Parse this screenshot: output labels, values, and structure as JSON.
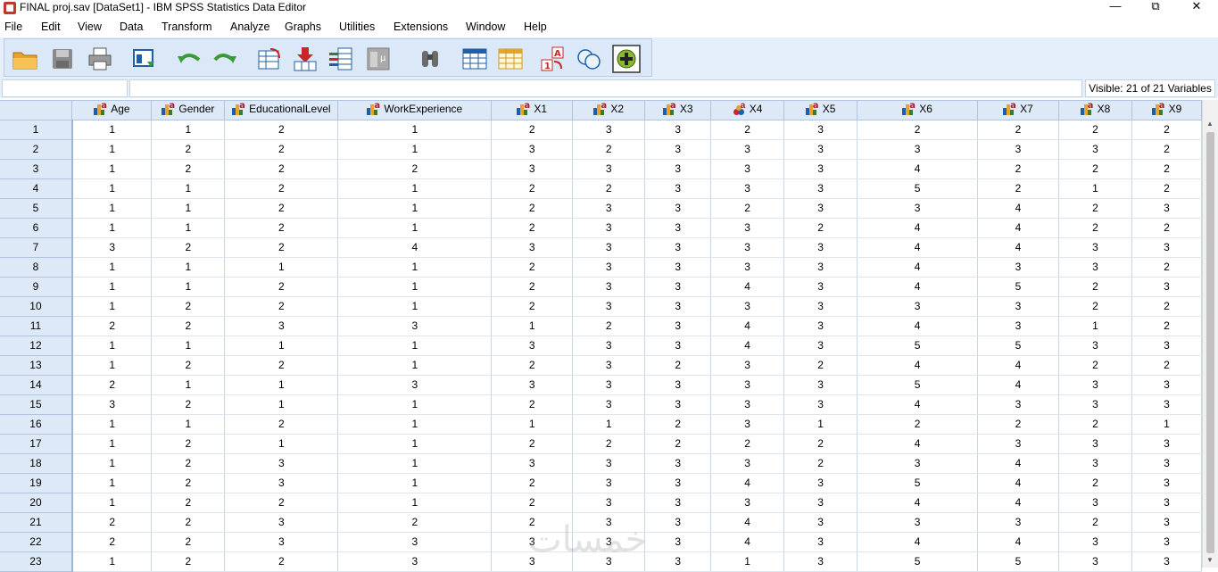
{
  "window": {
    "title": "FINAL proj.sav [DataSet1] - IBM SPSS Statistics Data Editor",
    "minimize": "—",
    "restore": "⧉",
    "close": "✕"
  },
  "menu": [
    "File",
    "Edit",
    "View",
    "Data",
    "Transform",
    "Analyze",
    "Graphs",
    "Utilities",
    "Extensions",
    "Window",
    "Help"
  ],
  "toolbar": {
    "icons": [
      "open-folder-icon",
      "save-icon",
      "print-icon",
      "recall-dialog-icon",
      "undo-icon",
      "redo-icon",
      "go-to-case-icon",
      "go-to-variable-icon",
      "variables-icon",
      "run-descriptives-icon",
      "find-icon",
      "insert-cases-icon",
      "insert-variable-icon",
      "value-labels-icon",
      "use-variable-sets-icon",
      "show-all-variables-icon"
    ]
  },
  "cellbar": {
    "cell_ref": "",
    "cell_value": "",
    "visible_label": "Visible: 21 of 21 Variables"
  },
  "grid": {
    "columns": [
      {
        "name": "Age",
        "icon": "scale"
      },
      {
        "name": "Gender",
        "icon": "scale"
      },
      {
        "name": "EducationalLevel",
        "icon": "scale"
      },
      {
        "name": "WorkExperience",
        "icon": "scale"
      },
      {
        "name": "X1",
        "icon": "scale"
      },
      {
        "name": "X2",
        "icon": "scale"
      },
      {
        "name": "X3",
        "icon": "scale"
      },
      {
        "name": "X4",
        "icon": "nominal"
      },
      {
        "name": "X5",
        "icon": "scale"
      },
      {
        "name": "X6",
        "icon": "scale"
      },
      {
        "name": "X7",
        "icon": "scale"
      },
      {
        "name": "X8",
        "icon": "scale"
      },
      {
        "name": "X9",
        "icon": "scale"
      }
    ],
    "rows": [
      [
        "1",
        "1",
        "2",
        "1",
        "2",
        "3",
        "3",
        "2",
        "3",
        "2",
        "2",
        "2",
        "2"
      ],
      [
        "1",
        "2",
        "2",
        "1",
        "3",
        "2",
        "3",
        "3",
        "3",
        "3",
        "3",
        "3",
        "2"
      ],
      [
        "1",
        "2",
        "2",
        "2",
        "3",
        "3",
        "3",
        "3",
        "3",
        "4",
        "2",
        "2",
        "2"
      ],
      [
        "1",
        "1",
        "2",
        "1",
        "2",
        "2",
        "3",
        "3",
        "3",
        "5",
        "2",
        "1",
        "2"
      ],
      [
        "1",
        "1",
        "2",
        "1",
        "2",
        "3",
        "3",
        "2",
        "3",
        "3",
        "4",
        "2",
        "3"
      ],
      [
        "1",
        "1",
        "2",
        "1",
        "2",
        "3",
        "3",
        "3",
        "2",
        "4",
        "4",
        "2",
        "2"
      ],
      [
        "3",
        "2",
        "2",
        "4",
        "3",
        "3",
        "3",
        "3",
        "3",
        "4",
        "4",
        "3",
        "3"
      ],
      [
        "1",
        "1",
        "1",
        "1",
        "2",
        "3",
        "3",
        "3",
        "3",
        "4",
        "3",
        "3",
        "2"
      ],
      [
        "1",
        "1",
        "2",
        "1",
        "2",
        "3",
        "3",
        "4",
        "3",
        "4",
        "5",
        "2",
        "3"
      ],
      [
        "1",
        "2",
        "2",
        "1",
        "2",
        "3",
        "3",
        "3",
        "3",
        "3",
        "3",
        "2",
        "2"
      ],
      [
        "2",
        "2",
        "3",
        "3",
        "1",
        "2",
        "3",
        "4",
        "3",
        "4",
        "3",
        "1",
        "2"
      ],
      [
        "1",
        "1",
        "1",
        "1",
        "3",
        "3",
        "3",
        "4",
        "3",
        "5",
        "5",
        "3",
        "3"
      ],
      [
        "1",
        "2",
        "2",
        "1",
        "2",
        "3",
        "2",
        "3",
        "2",
        "4",
        "4",
        "2",
        "2"
      ],
      [
        "2",
        "1",
        "1",
        "3",
        "3",
        "3",
        "3",
        "3",
        "3",
        "5",
        "4",
        "3",
        "3"
      ],
      [
        "3",
        "2",
        "1",
        "1",
        "2",
        "3",
        "3",
        "3",
        "3",
        "4",
        "3",
        "3",
        "3"
      ],
      [
        "1",
        "1",
        "2",
        "1",
        "1",
        "1",
        "2",
        "3",
        "1",
        "2",
        "2",
        "2",
        "1"
      ],
      [
        "1",
        "2",
        "1",
        "1",
        "2",
        "2",
        "2",
        "2",
        "2",
        "4",
        "3",
        "3",
        "3"
      ],
      [
        "1",
        "2",
        "3",
        "1",
        "3",
        "3",
        "3",
        "3",
        "2",
        "3",
        "4",
        "3",
        "3"
      ],
      [
        "1",
        "2",
        "3",
        "1",
        "2",
        "3",
        "3",
        "4",
        "3",
        "5",
        "4",
        "2",
        "3"
      ],
      [
        "1",
        "2",
        "2",
        "1",
        "2",
        "3",
        "3",
        "3",
        "3",
        "4",
        "4",
        "3",
        "3"
      ],
      [
        "2",
        "2",
        "3",
        "2",
        "2",
        "3",
        "3",
        "4",
        "3",
        "3",
        "3",
        "2",
        "3"
      ],
      [
        "2",
        "2",
        "3",
        "3",
        "3",
        "3",
        "3",
        "4",
        "3",
        "4",
        "4",
        "3",
        "3"
      ],
      [
        "1",
        "2",
        "2",
        "3",
        "3",
        "3",
        "3",
        "1",
        "3",
        "5",
        "5",
        "3",
        "3"
      ]
    ]
  },
  "watermark": "خمسات"
}
